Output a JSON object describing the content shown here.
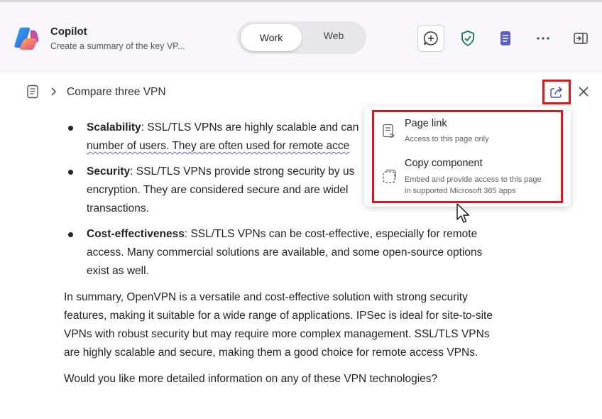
{
  "header": {
    "app_title": "Copilot",
    "app_subtitle": "Create a summary of the key VP...",
    "toggle": {
      "work_label": "Work",
      "web_label": "Web",
      "selected": "Work"
    },
    "icons": [
      "copilot-logo",
      "new-chat-icon",
      "shield-check-icon",
      "document-icon",
      "more-icon",
      "side-panel-icon"
    ],
    "colors": {
      "shield": "#107c41",
      "doc": "#5b5fc7",
      "highlight_red": "#e0161f"
    }
  },
  "breadcrumb": {
    "title": "Compare three VPN"
  },
  "content": {
    "bullets": [
      {
        "term": "Scalability",
        "lines": [
          "SSL/TLS VPNs are highly scalable and can",
          "number of users. They are often used for remote acce"
        ]
      },
      {
        "term": "Security",
        "lines": [
          "SSL/TLS VPNs provide strong security by us",
          "encryption. They are considered secure and are widel",
          "transactions."
        ]
      },
      {
        "term": "Cost-effectiveness",
        "lines": [
          "SSL/TLS VPNs can be cost-effective, especially for remote",
          "access. Many commercial solutions are available, and some open-source options",
          "exist as well."
        ]
      }
    ],
    "summary_lines": [
      "In summary, OpenVPN is a versatile and cost-effective solution with strong security",
      "features, making it suitable for a wide range of applications. IPSec is ideal for site-to-site",
      "VPNs with robust security but may require more complex management. SSL/TLS VPNs",
      "are highly scalable and secure, making them a good choice for remote access VPNs."
    ],
    "question": "Would you like more detailed information on any of these VPN technologies?"
  },
  "share_menu": {
    "items": [
      {
        "title": "Page link",
        "subtitle": "Access to this page only"
      },
      {
        "title": "Copy component",
        "subtitle_lines": [
          "Embed and provide access to this page",
          "in supported Microsoft 365 apps"
        ]
      }
    ]
  }
}
